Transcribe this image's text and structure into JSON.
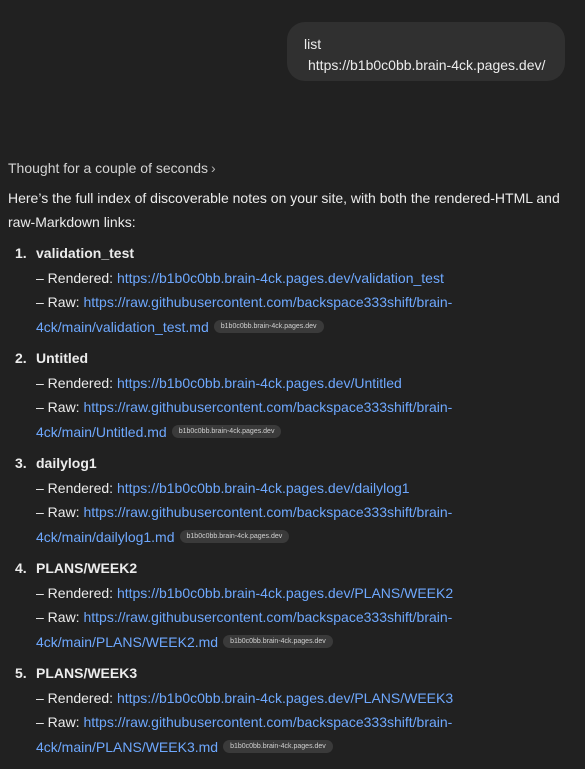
{
  "user_message": {
    "line1": "list",
    "line2": "https://b1b0c0bb.brain-4ck.pages.dev/"
  },
  "thought": {
    "label": "Thought for a couple of seconds",
    "icon": "chevron-right-icon"
  },
  "intro": "Here’s the full index of discoverable notes on your site, with both the rendered-HTML and raw-Markdown links:",
  "colors": {
    "background": "#212121",
    "bubble": "#303030",
    "link": "#6ea8fe",
    "chip": "#3a3a3a"
  },
  "notes": [
    {
      "number": "1.",
      "title": "validation_test",
      "rendered_prefix": "– Rendered: ",
      "rendered_url": "https://b1b0c0bb.brain-4ck.pages.dev/validation_test",
      "raw_prefix": "– Raw: ",
      "raw_url_part1": "https://raw.githubusercontent.com/backspace333shift/brain-",
      "raw_url_part2": "4ck/main/validation_test.md",
      "source_chip": "b1b0c0bb.brain-4ck.pages.dev"
    },
    {
      "number": "2.",
      "title": "Untitled",
      "rendered_prefix": "– Rendered: ",
      "rendered_url": "https://b1b0c0bb.brain-4ck.pages.dev/Untitled",
      "raw_prefix": "– Raw: ",
      "raw_url_part1": "https://raw.githubusercontent.com/backspace333shift/brain-",
      "raw_url_part2": "4ck/main/Untitled.md",
      "source_chip": "b1b0c0bb.brain-4ck.pages.dev"
    },
    {
      "number": "3.",
      "title": "dailylog1",
      "rendered_prefix": "– Rendered: ",
      "rendered_url": "https://b1b0c0bb.brain-4ck.pages.dev/dailylog1",
      "raw_prefix": "– Raw: ",
      "raw_url_part1": "https://raw.githubusercontent.com/backspace333shift/brain-",
      "raw_url_part2": "4ck/main/dailylog1.md",
      "source_chip": "b1b0c0bb.brain-4ck.pages.dev"
    },
    {
      "number": "4.",
      "title": "PLANS/WEEK2",
      "rendered_prefix": "– Rendered: ",
      "rendered_url": "https://b1b0c0bb.brain-4ck.pages.dev/PLANS/WEEK2",
      "raw_prefix": "– Raw: ",
      "raw_url_part1": "https://raw.githubusercontent.com/backspace333shift/brain-",
      "raw_url_part2": "4ck/main/PLANS/WEEK2.md",
      "source_chip": "b1b0c0bb.brain-4ck.pages.dev"
    },
    {
      "number": "5.",
      "title": "PLANS/WEEK3",
      "rendered_prefix": "– Rendered: ",
      "rendered_url": "https://b1b0c0bb.brain-4ck.pages.dev/PLANS/WEEK3",
      "raw_prefix": "– Raw: ",
      "raw_url_part1": "https://raw.githubusercontent.com/backspace333shift/brain-",
      "raw_url_part2": "4ck/main/PLANS/WEEK3.md",
      "source_chip": "b1b0c0bb.brain-4ck.pages.dev"
    }
  ]
}
